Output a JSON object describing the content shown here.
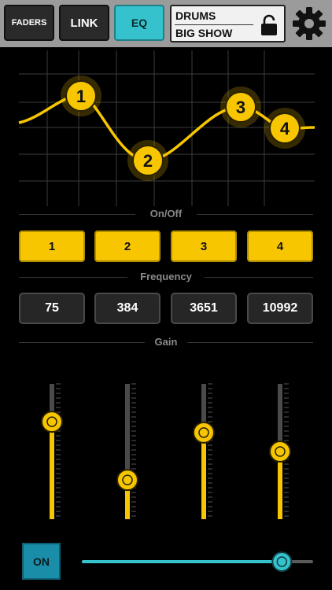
{
  "topbar": {
    "faders_label": "FADERS",
    "link_label": "LINK",
    "eq_label": "EQ",
    "preset_line1": "DRUMS",
    "preset_line2": "BIG SHOW",
    "lock_icon": "lock-icon",
    "settings_icon": "gear-icon",
    "active_color": "#35c2cc"
  },
  "eq_graph": {
    "curve_color": "#f7c600",
    "bands": [
      {
        "label": "1"
      },
      {
        "label": "2"
      },
      {
        "label": "3"
      },
      {
        "label": "4"
      }
    ]
  },
  "onoff": {
    "label": "On/Off",
    "bands": [
      {
        "label": "1",
        "on": true
      },
      {
        "label": "2",
        "on": true
      },
      {
        "label": "3",
        "on": true
      },
      {
        "label": "4",
        "on": true
      }
    ]
  },
  "frequency": {
    "label": "Frequency",
    "values": [
      "75",
      "384",
      "3651",
      "10992"
    ]
  },
  "gain": {
    "label": "Gain",
    "levels": [
      0.72,
      0.29,
      0.64,
      0.5
    ]
  },
  "bottom": {
    "on_label": "ON",
    "slider_level": 0.87,
    "slider_color": "#35c2cc"
  }
}
